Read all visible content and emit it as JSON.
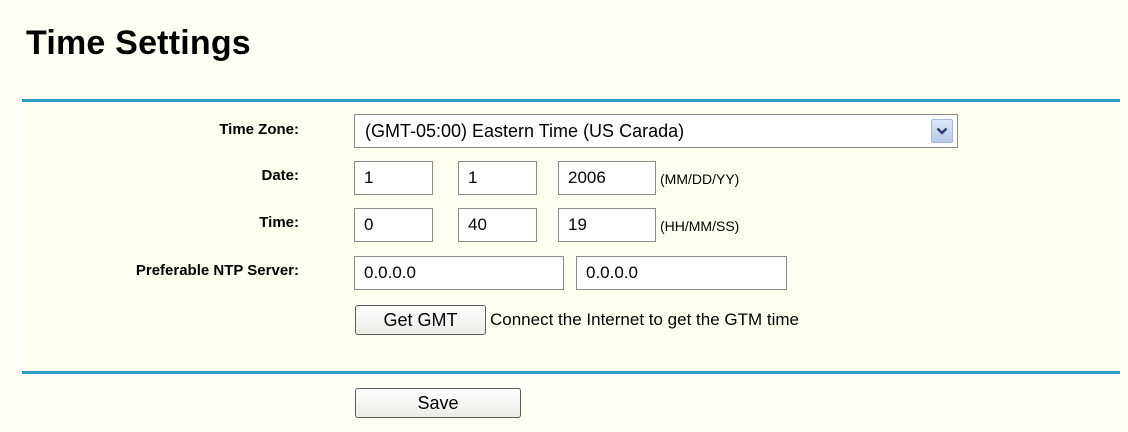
{
  "page": {
    "title": "Time Settings"
  },
  "form": {
    "time_zone": {
      "label": "Time Zone:",
      "selected": "(GMT-05:00) Eastern Time (US Carada)"
    },
    "date": {
      "label": "Date:",
      "month": "1",
      "day": "1",
      "year": "2006",
      "format_hint": "(MM/DD/YY)"
    },
    "time": {
      "label": "Time:",
      "hour": "0",
      "minute": "40",
      "second": "19",
      "format_hint": "(HH/MM/SS)"
    },
    "ntp": {
      "label": "Preferable NTP Server:",
      "server1": "0.0.0.0",
      "server2": "0.0.0.0"
    },
    "get_gmt": {
      "button_label": "Get GMT",
      "description": "Connect the Internet to get the GTM time"
    }
  },
  "actions": {
    "save_label": "Save"
  },
  "colors": {
    "rule": "#2d9ac9",
    "background": "#fffff5"
  },
  "icons": {
    "dropdown": "chevron-down-icon"
  }
}
